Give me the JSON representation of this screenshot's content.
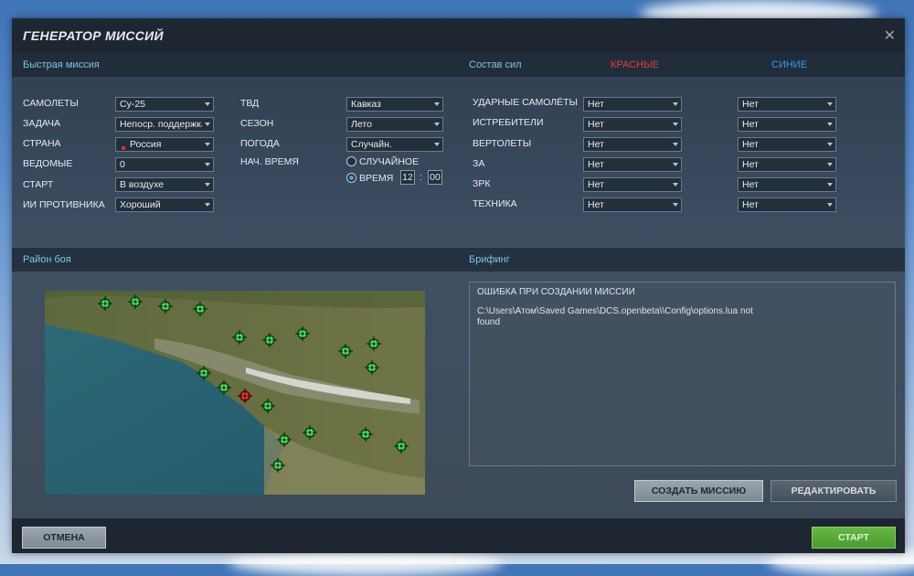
{
  "window": {
    "title": "ГЕНЕРАТОР МИССИЙ"
  },
  "quick": {
    "header": "Быстрая миссия",
    "fields": [
      {
        "label": "САМОЛЕТЫ",
        "value": "Су-25"
      },
      {
        "label": "ЗАДАЧА",
        "value": "Непоср. поддержка"
      },
      {
        "label": "СТРАНА",
        "value": "Россия"
      },
      {
        "label": "ВЕДОМЫЕ",
        "value": "0"
      },
      {
        "label": "СТАРТ",
        "value": "В воздухе"
      },
      {
        "label": "ИИ ПРОТИВНИКА",
        "value": "Хороший"
      }
    ],
    "env": [
      {
        "label": "ТВД",
        "value": "Кавказ"
      },
      {
        "label": "СЕЗОН",
        "value": "Лето"
      },
      {
        "label": "ПОГОДА",
        "value": "Случайн."
      }
    ],
    "start_time": {
      "label": "НАЧ. ВРЕМЯ",
      "random_label": "СЛУЧАЙНОЕ",
      "time_label": "ВРЕМЯ",
      "hour": "12",
      "separator": ":",
      "minute": "00",
      "selected": "time"
    }
  },
  "forces": {
    "header": "Состав сил",
    "red_label": "КРАСНЫЕ",
    "blue_label": "СИНИЕ",
    "red_color": "#e33c3c",
    "blue_color": "#2f9ee8",
    "rows": [
      {
        "label": "УДАРНЫЕ САМОЛЁТЫ",
        "red": "Нет",
        "blue": "Нет"
      },
      {
        "label": "ИСТРЕБИТЕЛИ",
        "red": "Нет",
        "blue": "Нет"
      },
      {
        "label": "ВЕРТОЛЕТЫ",
        "red": "Нет",
        "blue": "Нет"
      },
      {
        "label": "ЗА",
        "red": "Нет",
        "blue": "Нет"
      },
      {
        "label": "ЗРК",
        "red": "Нет",
        "blue": "Нет"
      },
      {
        "label": "ТЕХНИКА",
        "red": "Нет",
        "blue": "Нет"
      }
    ]
  },
  "combat_area": {
    "header": "Район боя"
  },
  "briefing": {
    "header": "Брифинг",
    "error_title": "ОШИБКА ПРИ СОЗДАНИИ МИССИИ",
    "error_line1": "C:\\Users\\Атом\\Saved Games\\DCS.openbeta\\\\Config\\options.lua not",
    "error_line2": "found"
  },
  "buttons": {
    "create": "СОЗДАТЬ МИССИЮ",
    "edit": "РЕДАКТИРОВАТЬ",
    "cancel": "ОТМЕНА",
    "start": "СТАРТ"
  }
}
